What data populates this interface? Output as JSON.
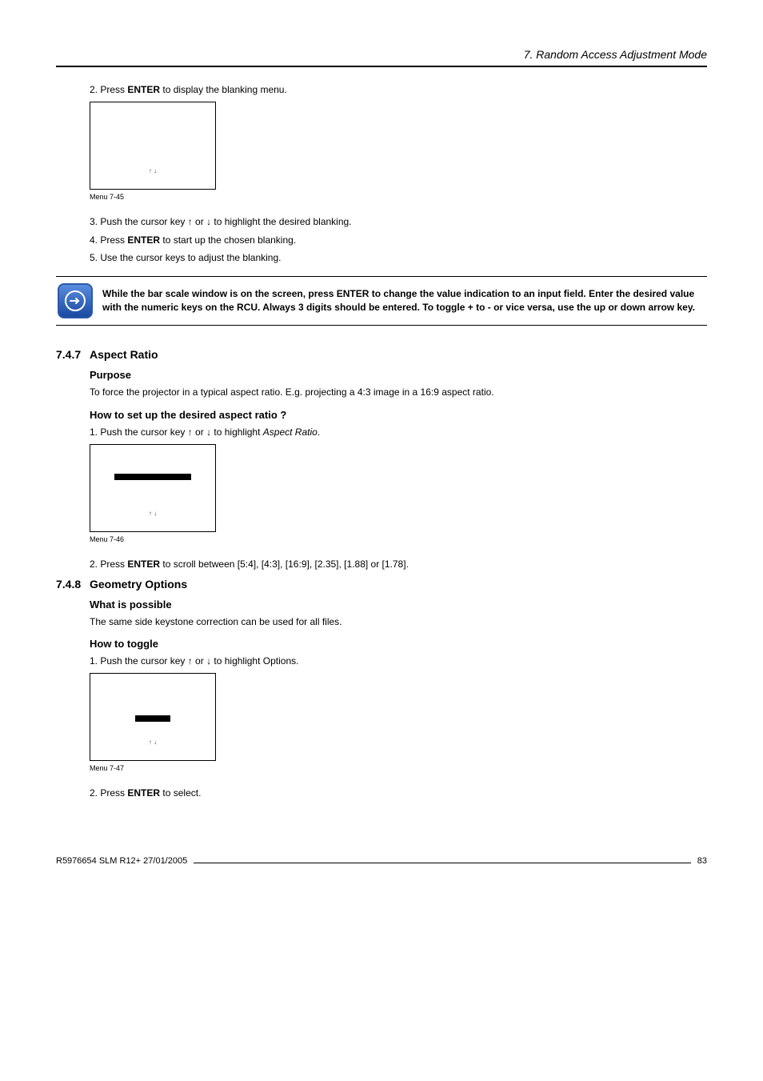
{
  "header": {
    "chapter_title": "7.  Random Access Adjustment Mode"
  },
  "block1": {
    "step2": {
      "num": "2.",
      "pre": "Press ",
      "bold": "ENTER",
      "post": " to display the blanking menu."
    },
    "menu_caption": "Menu 7-45",
    "step3": "3.  Push the cursor key ↑ or ↓ to highlight the desired blanking.",
    "step4": {
      "num": "4.",
      "pre": "Press ",
      "bold": "ENTER",
      "post": " to start up the chosen blanking."
    },
    "step5": "5.  Use the cursor keys to adjust the blanking."
  },
  "note": {
    "line1": "While the bar scale window is on the screen, press ENTER to change the value indication to an input field. Enter the desired value with the numeric keys on the RCU. Always 3 digits should be entered. To toggle + to - or vice versa, use the up or down arrow key."
  },
  "sec747": {
    "num": "7.4.7",
    "title": "Aspect Ratio",
    "purpose_h": "Purpose",
    "purpose_t": "To force the projector in a typical aspect ratio.  E.g.  projecting a 4:3 image in a 16:9 aspect ratio.",
    "how_h": "How to set up the desired aspect ratio ?",
    "step1": {
      "pre": "1.  Push the cursor key ↑ or ↓ to highlight ",
      "ital": "Aspect Ratio",
      "post": "."
    },
    "menu_caption": "Menu 7-46",
    "step2": {
      "num": "2.",
      "pre": "Press ",
      "bold": "ENTER",
      "post": " to scroll between [5:4], [4:3], [16:9], [2.35], [1.88] or [1.78]."
    }
  },
  "sec748": {
    "num": "7.4.8",
    "title": "Geometry Options",
    "what_h": "What is possible",
    "what_t": "The same side keystone correction can be used for all files.",
    "how_h": "How to toggle",
    "step1": "1.  Push the cursor key ↑ or ↓ to highlight Options.",
    "menu_caption": "Menu 7-47",
    "step2": {
      "num": "2.",
      "pre": "Press ",
      "bold": "ENTER",
      "post": " to select."
    }
  },
  "footer": {
    "left": "R5976654  SLM R12+  27/01/2005",
    "right": "83"
  },
  "arrows": "↑     ↓"
}
